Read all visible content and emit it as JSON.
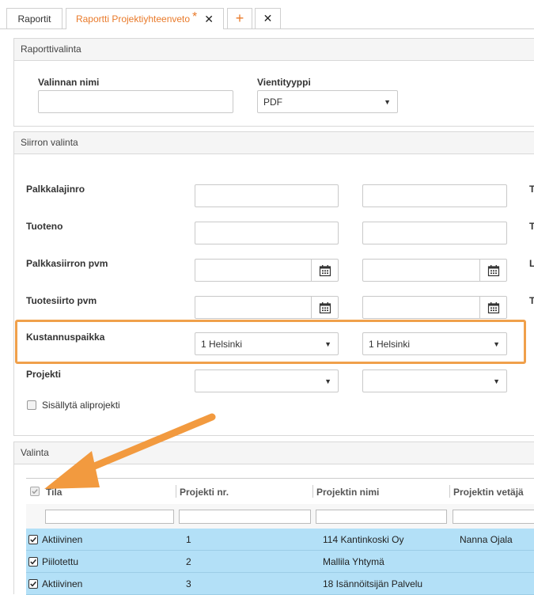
{
  "tabs": [
    {
      "label": "Raportit"
    },
    {
      "label": "Raportti Projektiyhteenveto",
      "modified_marker": "*",
      "close": "✕"
    },
    {
      "label": "+"
    },
    {
      "label": "✕"
    }
  ],
  "report_select": {
    "header": "Raporttivalinta",
    "name_label": "Valinnan nimi",
    "name_value": "",
    "export_label": "Vientityyppi",
    "export_value": "PDF"
  },
  "transfer_select": {
    "header": "Siirron valinta",
    "fields": [
      {
        "label": "Palkkalajinro",
        "from": "",
        "to": "",
        "side_label": "T"
      },
      {
        "label": "Tuoteno",
        "from": "",
        "to": "",
        "side_label": "T"
      },
      {
        "label": "Palkkasiirron pvm",
        "from": "",
        "to": "",
        "side_label": "L"
      },
      {
        "label": "Tuotesiirto pvm",
        "from": "",
        "to": "",
        "side_label": "T"
      },
      {
        "label": "Kustannuspaikka",
        "from": "1 Helsinki",
        "to": "1 Helsinki"
      },
      {
        "label": "Projekti",
        "from": "",
        "to": ""
      }
    ],
    "include_subprojects_label": "Sisällytä aliprojekti"
  },
  "selection": {
    "header": "Valinta",
    "columns": [
      "Tila",
      "Projekti nr.",
      "Projektin nimi",
      "Projektin vetäjä"
    ],
    "rows": [
      {
        "status": "Aktiivinen",
        "number": "1",
        "name": "114 Kantinkoski Oy",
        "manager": "Nanna Ojala"
      },
      {
        "status": "Piilotettu",
        "number": "2",
        "name": "Mallila Yhtymä",
        "manager": ""
      },
      {
        "status": "Aktiivinen",
        "number": "3",
        "name": "18 Isännöitsijän Palvelu",
        "manager": ""
      }
    ]
  },
  "colors": {
    "accent": "#e97a2a",
    "highlight": "#f0a04b",
    "row_selected": "#b3e0f7"
  }
}
